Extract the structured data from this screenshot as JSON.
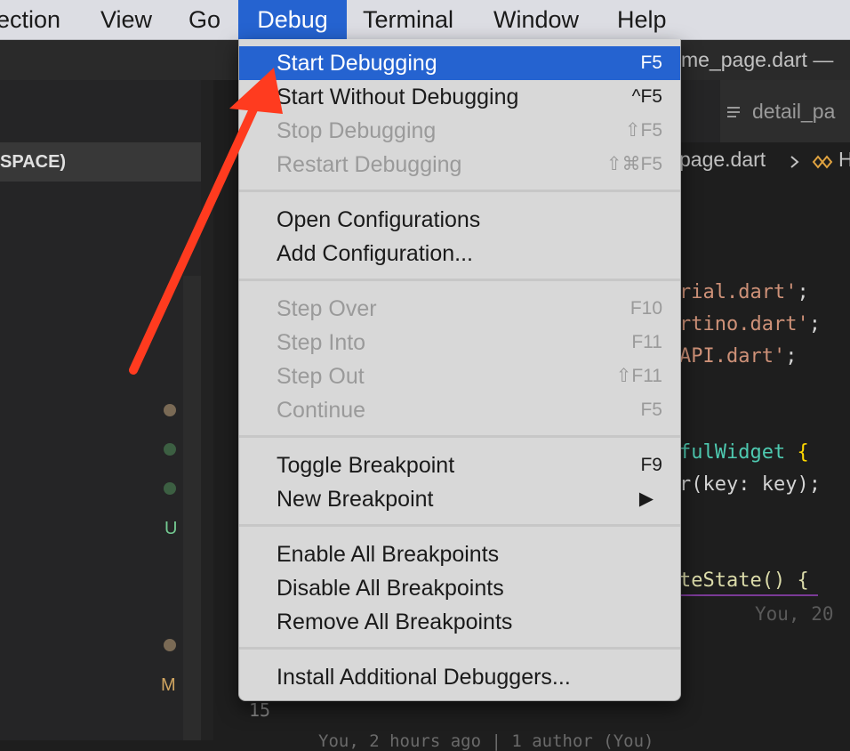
{
  "menubar": {
    "items": [
      "ection",
      "View",
      "Go",
      "Debug",
      "Terminal",
      "Window",
      "Help"
    ]
  },
  "window": {
    "title": "me_page.dart —"
  },
  "sidebar": {
    "header": "SPACE)",
    "git_status": [
      "U",
      "M"
    ]
  },
  "editor": {
    "tab_label": "detail_pa",
    "breadcrumbs": "page.dart",
    "breadcrumb_tail": "H",
    "code_lines": [
      [
        "rial.dart'",
        ";"
      ],
      [
        "rtino.dart'",
        ";"
      ],
      [
        "API.dart'",
        ";"
      ],
      [
        "fulWidget",
        "{"
      ],
      [
        "r(key: key);"
      ],
      [
        "teState() {"
      ]
    ],
    "blame": "You, 20",
    "line_number": "15",
    "bottom_text": "You, 2 hours ago | 1 author (You)"
  },
  "debug_menu": {
    "items": [
      {
        "label": "Start Debugging",
        "shortcut": "F5"
      },
      {
        "label": "Start Without Debugging",
        "shortcut": "^F5"
      },
      {
        "label": "Stop Debugging",
        "shortcut": "⇧F5"
      },
      {
        "label": "Restart Debugging",
        "shortcut": "⇧⌘F5"
      },
      {
        "label": "Open Configurations",
        "shortcut": ""
      },
      {
        "label": "Add Configuration...",
        "shortcut": ""
      },
      {
        "label": "Step Over",
        "shortcut": "F10"
      },
      {
        "label": "Step Into",
        "shortcut": "F11"
      },
      {
        "label": "Step Out",
        "shortcut": "⇧F11"
      },
      {
        "label": "Continue",
        "shortcut": "F5"
      },
      {
        "label": "Toggle Breakpoint",
        "shortcut": "F9"
      },
      {
        "label": "New Breakpoint",
        "shortcut": "▶"
      },
      {
        "label": "Enable All Breakpoints",
        "shortcut": ""
      },
      {
        "label": "Disable All Breakpoints",
        "shortcut": ""
      },
      {
        "label": "Remove All Breakpoints",
        "shortcut": ""
      },
      {
        "label": "Install Additional Debuggers...",
        "shortcut": ""
      }
    ]
  },
  "annotation": {
    "arrow_color": "#ff3b1f",
    "icon": "red-arrow-icon"
  },
  "colors": {
    "menu_highlight": "#2563d0",
    "menu_bg": "#d8d8d8",
    "editor_bg": "#1e1e1e"
  }
}
